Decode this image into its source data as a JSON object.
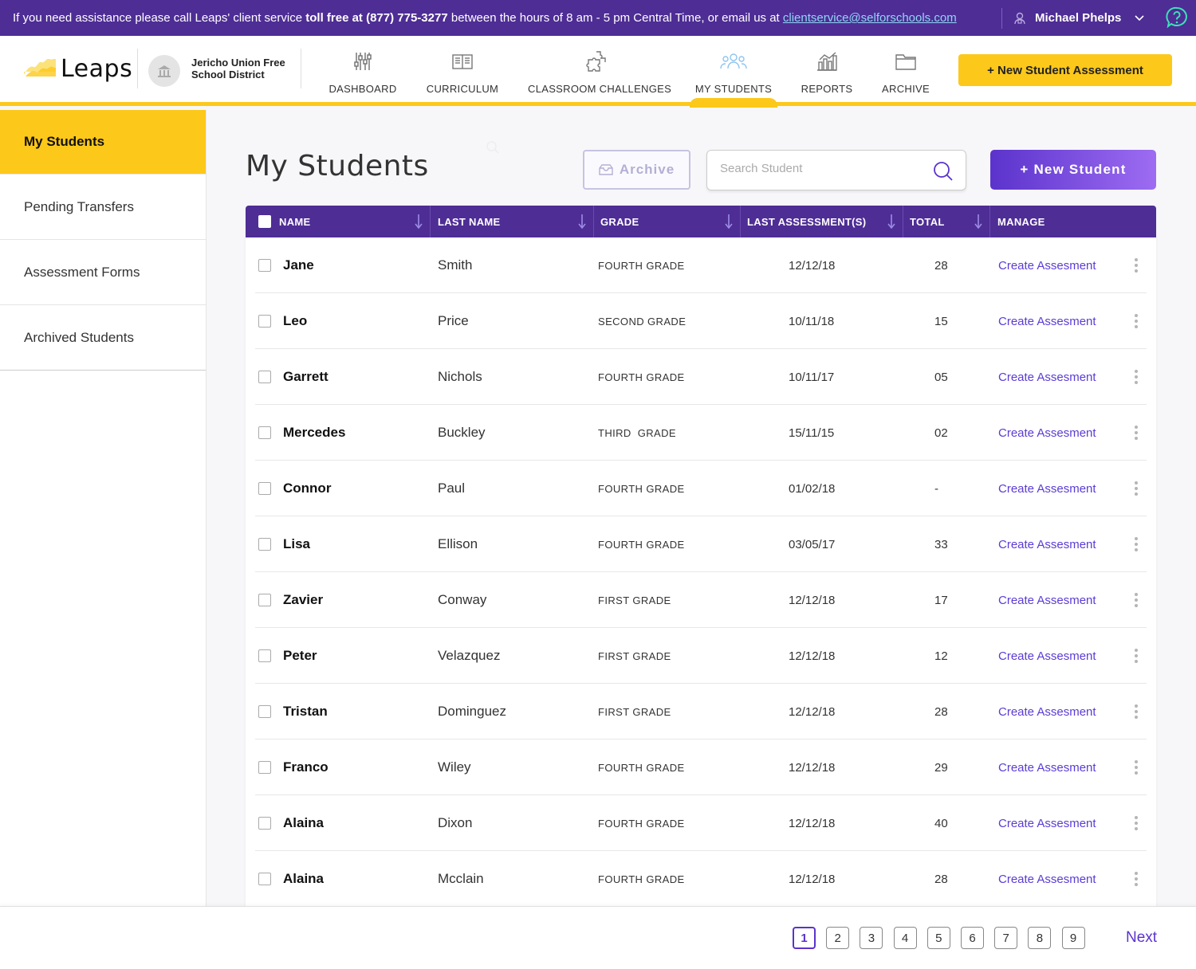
{
  "infobar": {
    "message_prefix": "If you need assistance please call Leaps' client service ",
    "message_bold": "toll free at (877) 775-3277",
    "message_suffix": " between the hours of 8 am - 5 pm Central Time, or email us at ",
    "email": "clientservice@selforschools.com",
    "user_name": "Michael Phelps"
  },
  "header": {
    "logo_text": "Leaps",
    "district_name": "Jericho Union Free School District",
    "nav": [
      {
        "label": "DASHBOARD",
        "icon": "sliders-icon"
      },
      {
        "label": "CURRICULUM",
        "icon": "book-icon"
      },
      {
        "label": "CLASSROOM CHALLENGES",
        "icon": "puzzle-icon"
      },
      {
        "label": "MY STUDENTS",
        "icon": "students-icon",
        "active": true
      },
      {
        "label": "REPORTS",
        "icon": "chart-icon"
      },
      {
        "label": "ARCHIVE",
        "icon": "folder-icon"
      }
    ],
    "new_assessment_label": "+ New Student Assessment"
  },
  "sidebar": {
    "items": [
      {
        "label": "My Students",
        "active": true
      },
      {
        "label": "Pending Transfers"
      },
      {
        "label": "Assessment Forms"
      },
      {
        "label": "Archived Students"
      }
    ]
  },
  "main": {
    "title": "My Students",
    "archive_label": "Archive",
    "search_placeholder": "Search Student",
    "new_student_label": "+ New Student"
  },
  "table": {
    "columns": [
      "NAME",
      "LAST NAME",
      "GRADE",
      "LAST ASSESSMENT(S)",
      "TOTAL",
      "MANAGE"
    ],
    "action_label": "Create Assesment",
    "rows": [
      {
        "first": "Jane",
        "last": "Smith",
        "grade": "FOURTH GRADE",
        "date": "12/12/18",
        "total": "28"
      },
      {
        "first": "Leo",
        "last": "Price",
        "grade": "SECOND GRADE",
        "date": "10/11/18",
        "total": "15"
      },
      {
        "first": "Garrett",
        "last": "Nichols",
        "grade": "FOURTH GRADE",
        "date": "10/11/17",
        "total": "05"
      },
      {
        "first": "Mercedes",
        "last": "Buckley",
        "grade": "THIRD  GRADE",
        "date": "15/11/15",
        "total": "02"
      },
      {
        "first": "Connor",
        "last": "Paul",
        "grade": "FOURTH GRADE",
        "date": "01/02/18",
        "total": "-"
      },
      {
        "first": "Lisa",
        "last": "Ellison",
        "grade": "FOURTH GRADE",
        "date": "03/05/17",
        "total": "33"
      },
      {
        "first": "Zavier",
        "last": "Conway",
        "grade": "FIRST GRADE",
        "date": "12/12/18",
        "total": "17"
      },
      {
        "first": "Peter",
        "last": "Velazquez",
        "grade": "FIRST GRADE",
        "date": "12/12/18",
        "total": "12"
      },
      {
        "first": "Tristan",
        "last": "Dominguez",
        "grade": "FIRST GRADE",
        "date": "12/12/18",
        "total": "28"
      },
      {
        "first": "Franco",
        "last": "Wiley",
        "grade": "FOURTH GRADE",
        "date": "12/12/18",
        "total": "29"
      },
      {
        "first": "Alaina",
        "last": "Dixon",
        "grade": "FOURTH GRADE",
        "date": "12/12/18",
        "total": "40"
      },
      {
        "first": "Alaina",
        "last": "Mcclain",
        "grade": "FOURTH GRADE",
        "date": "12/12/18",
        "total": "28"
      }
    ]
  },
  "pagination": {
    "pages": [
      "1",
      "2",
      "3",
      "4",
      "5",
      "6",
      "7",
      "8",
      "9"
    ],
    "current": "1",
    "next_label": "Next"
  },
  "colors": {
    "brand_purple": "#4e2d95",
    "accent_yellow": "#fcc81a",
    "link_purple": "#5b3bd4"
  }
}
